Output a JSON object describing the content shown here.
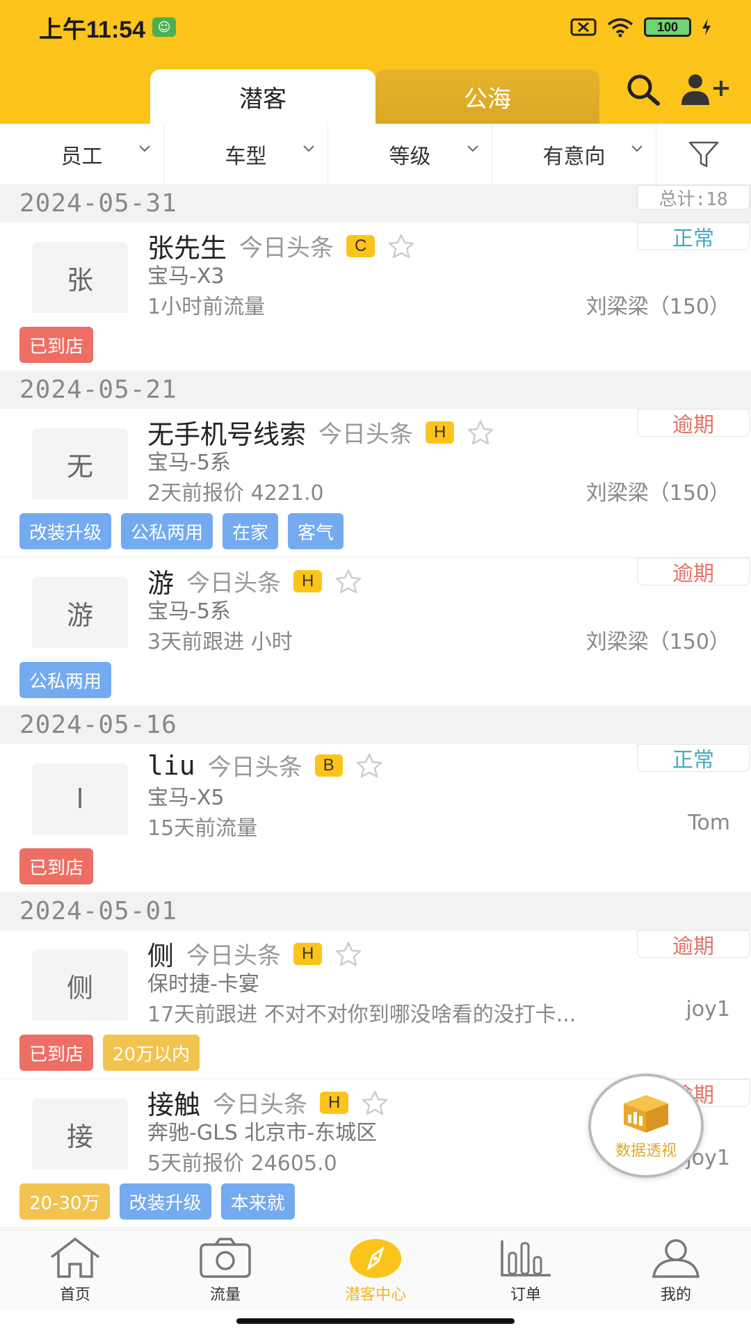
{
  "status_bar": {
    "time": "上午11:54",
    "battery": "100"
  },
  "header": {
    "tabs": [
      {
        "label": "潜客"
      },
      {
        "label": "公海"
      }
    ]
  },
  "filters": [
    {
      "label": "员工"
    },
    {
      "label": "车型"
    },
    {
      "label": "等级"
    },
    {
      "label": "有意向"
    }
  ],
  "total_label": "总计:18",
  "groups": [
    {
      "date": "2024-05-31"
    },
    {
      "date": "2024-05-21"
    },
    {
      "date": "2024-05-16"
    },
    {
      "date": "2024-05-01"
    }
  ],
  "customers": [
    {
      "avatar": "张",
      "name": "张先生",
      "source": "今日头条",
      "grade": "C",
      "car": "宝马-X3",
      "info": "1小时前流量",
      "owner": "刘梁梁（150）",
      "status": "正常",
      "tags": [
        "已到店"
      ]
    },
    {
      "avatar": "无",
      "name": "无手机号线索",
      "source": "今日头条",
      "grade": "H",
      "car": "宝马-5系",
      "info": "2天前报价  4221.0",
      "owner": "刘梁梁（150）",
      "status": "逾期",
      "tags": [
        "改装升级",
        "公私两用",
        "在家",
        "客气"
      ]
    },
    {
      "avatar": "游",
      "name": "游",
      "source": "今日头条",
      "grade": "H",
      "car": "宝马-5系",
      "info": "3天前跟进  小时",
      "owner": "刘梁梁（150）",
      "status": "逾期",
      "tags": [
        "公私两用"
      ]
    },
    {
      "avatar": "l",
      "name": "liu",
      "source": "今日头条",
      "grade": "B",
      "car": "宝马-X5",
      "info": "15天前流量",
      "owner": "Tom",
      "status": "正常",
      "tags": [
        "已到店"
      ]
    },
    {
      "avatar": "侧",
      "name": "侧",
      "source": "今日头条",
      "grade": "H",
      "car": "保时捷-卡宴",
      "info": "17天前跟进  不对不对你到哪没啥看的没打卡...",
      "owner": "joy1",
      "status": "逾期",
      "tags": [
        "已到店",
        "20万以内"
      ]
    },
    {
      "avatar": "接",
      "name": "接触",
      "source": "今日头条",
      "grade": "H",
      "car": "奔驰-GLS  北京市-东城区",
      "info": "5天前报价  24605.0",
      "owner": "joy1",
      "status": "逾期",
      "tags": [
        "20-30万",
        "改装升级",
        "本来就"
      ]
    }
  ],
  "fab": {
    "label": "数据透视"
  },
  "bottom_nav": [
    {
      "label": "首页",
      "icon": "home-icon"
    },
    {
      "label": "流量",
      "icon": "camera-icon"
    },
    {
      "label": "潜客中心",
      "icon": "compass-icon"
    },
    {
      "label": "订单",
      "icon": "bar-chart-icon"
    },
    {
      "label": "我的",
      "icon": "user-icon"
    }
  ],
  "colors": {
    "brand": "#FCC31B",
    "status_ok": "#49a8c2",
    "status_late": "#e57367",
    "tag_red": "#ec6e64",
    "tag_blue": "#74aaf0",
    "tag_yellow": "#f2c34e"
  }
}
